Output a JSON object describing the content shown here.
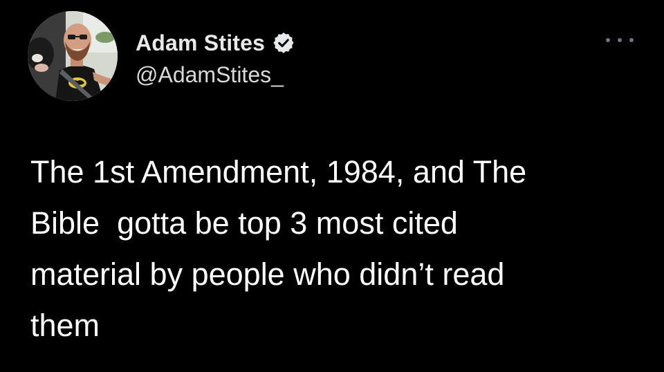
{
  "tweet": {
    "author": {
      "display_name": "Adam Stites",
      "handle": "@AdamStites_",
      "verified": true,
      "avatar_icon": "profile-photo",
      "verified_icon": "verified-badge-icon"
    },
    "menu_icon": "more-options-icon",
    "text": "The 1st Amendment, 1984, and The\nBible  gotta be top 3 most cited\nmaterial by people who didn’t read\nthem"
  },
  "colors": {
    "background": "#000000",
    "text": "#ffffff",
    "secondary_text": "#d9d9d9",
    "icon_gray": "#6e767d"
  }
}
